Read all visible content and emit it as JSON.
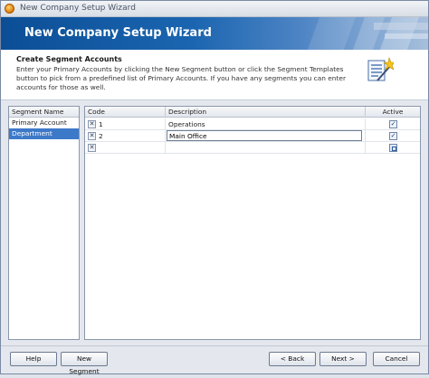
{
  "window": {
    "title": "New Company Setup Wizard"
  },
  "banner": {
    "title": "New Company Setup Wizard"
  },
  "header": {
    "title": "Create Segment Accounts",
    "description": "Enter your Primary Accounts by clicking the New Segment button or click the Segment Templates button to pick from a predefined list of Primary Accounts. If you have any segments you can enter accounts for those as well."
  },
  "segments": {
    "column": "Segment Name",
    "items": [
      {
        "label": "Primary Account",
        "selected": false
      },
      {
        "label": "Department",
        "selected": true
      }
    ]
  },
  "grid": {
    "columns": {
      "code": "Code",
      "description": "Description",
      "active": "Active"
    },
    "rows": [
      {
        "code": "1",
        "description": "Operations",
        "active": true
      },
      {
        "code": "2",
        "description": "Main Office",
        "active": true
      }
    ],
    "new_row": {
      "code": "",
      "description": ""
    }
  },
  "buttons": {
    "help": "Help",
    "new_segment": "New Segment",
    "back": "< Back",
    "next": "Next >",
    "cancel": "Cancel"
  },
  "colors": {
    "banner": "#1b65b0",
    "selection": "#3d79c9"
  },
  "icons": {
    "app": "app-orb-icon",
    "wizard": "wizard-wand-icon",
    "delete_row": "delete-x-icon",
    "checkbox": "checkbox-icon"
  }
}
